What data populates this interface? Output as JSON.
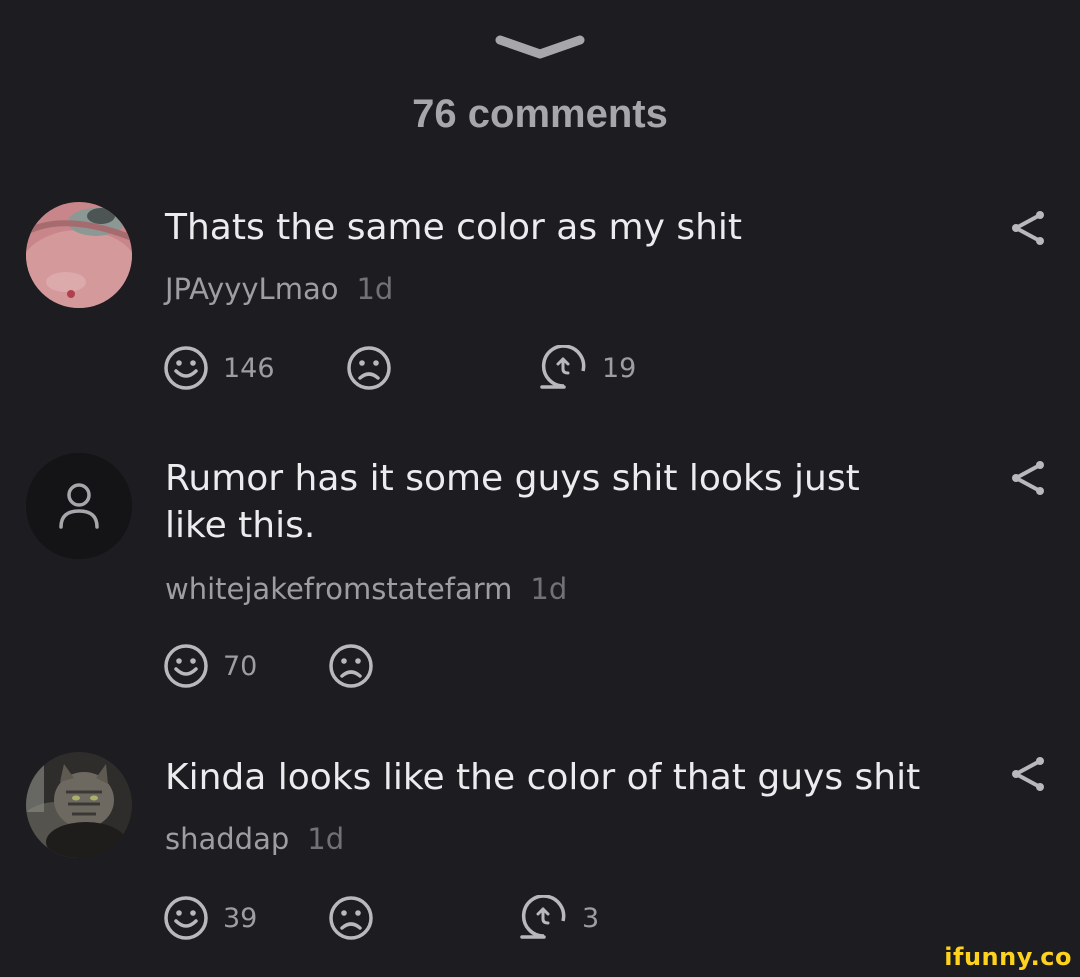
{
  "header": {
    "title": "76 comments"
  },
  "comments": [
    {
      "text": "Thats the same color as my shit",
      "author": "JPAyyyLmao",
      "time": "1d",
      "likes": "146",
      "replies": "19"
    },
    {
      "text": "Rumor has it some guys shit looks just like this.",
      "author": "whitejakefromstatefarm",
      "time": "1d",
      "likes": "70",
      "replies": ""
    },
    {
      "text": "Kinda looks like the color of that guys shit",
      "author": "shaddap",
      "time": "1d",
      "likes": "39",
      "replies": "3"
    }
  ],
  "watermark": "ifunny.co",
  "colors": {
    "background": "#1d1d21",
    "icon": "#b9b9bd",
    "watermark": "#ffd21e"
  }
}
